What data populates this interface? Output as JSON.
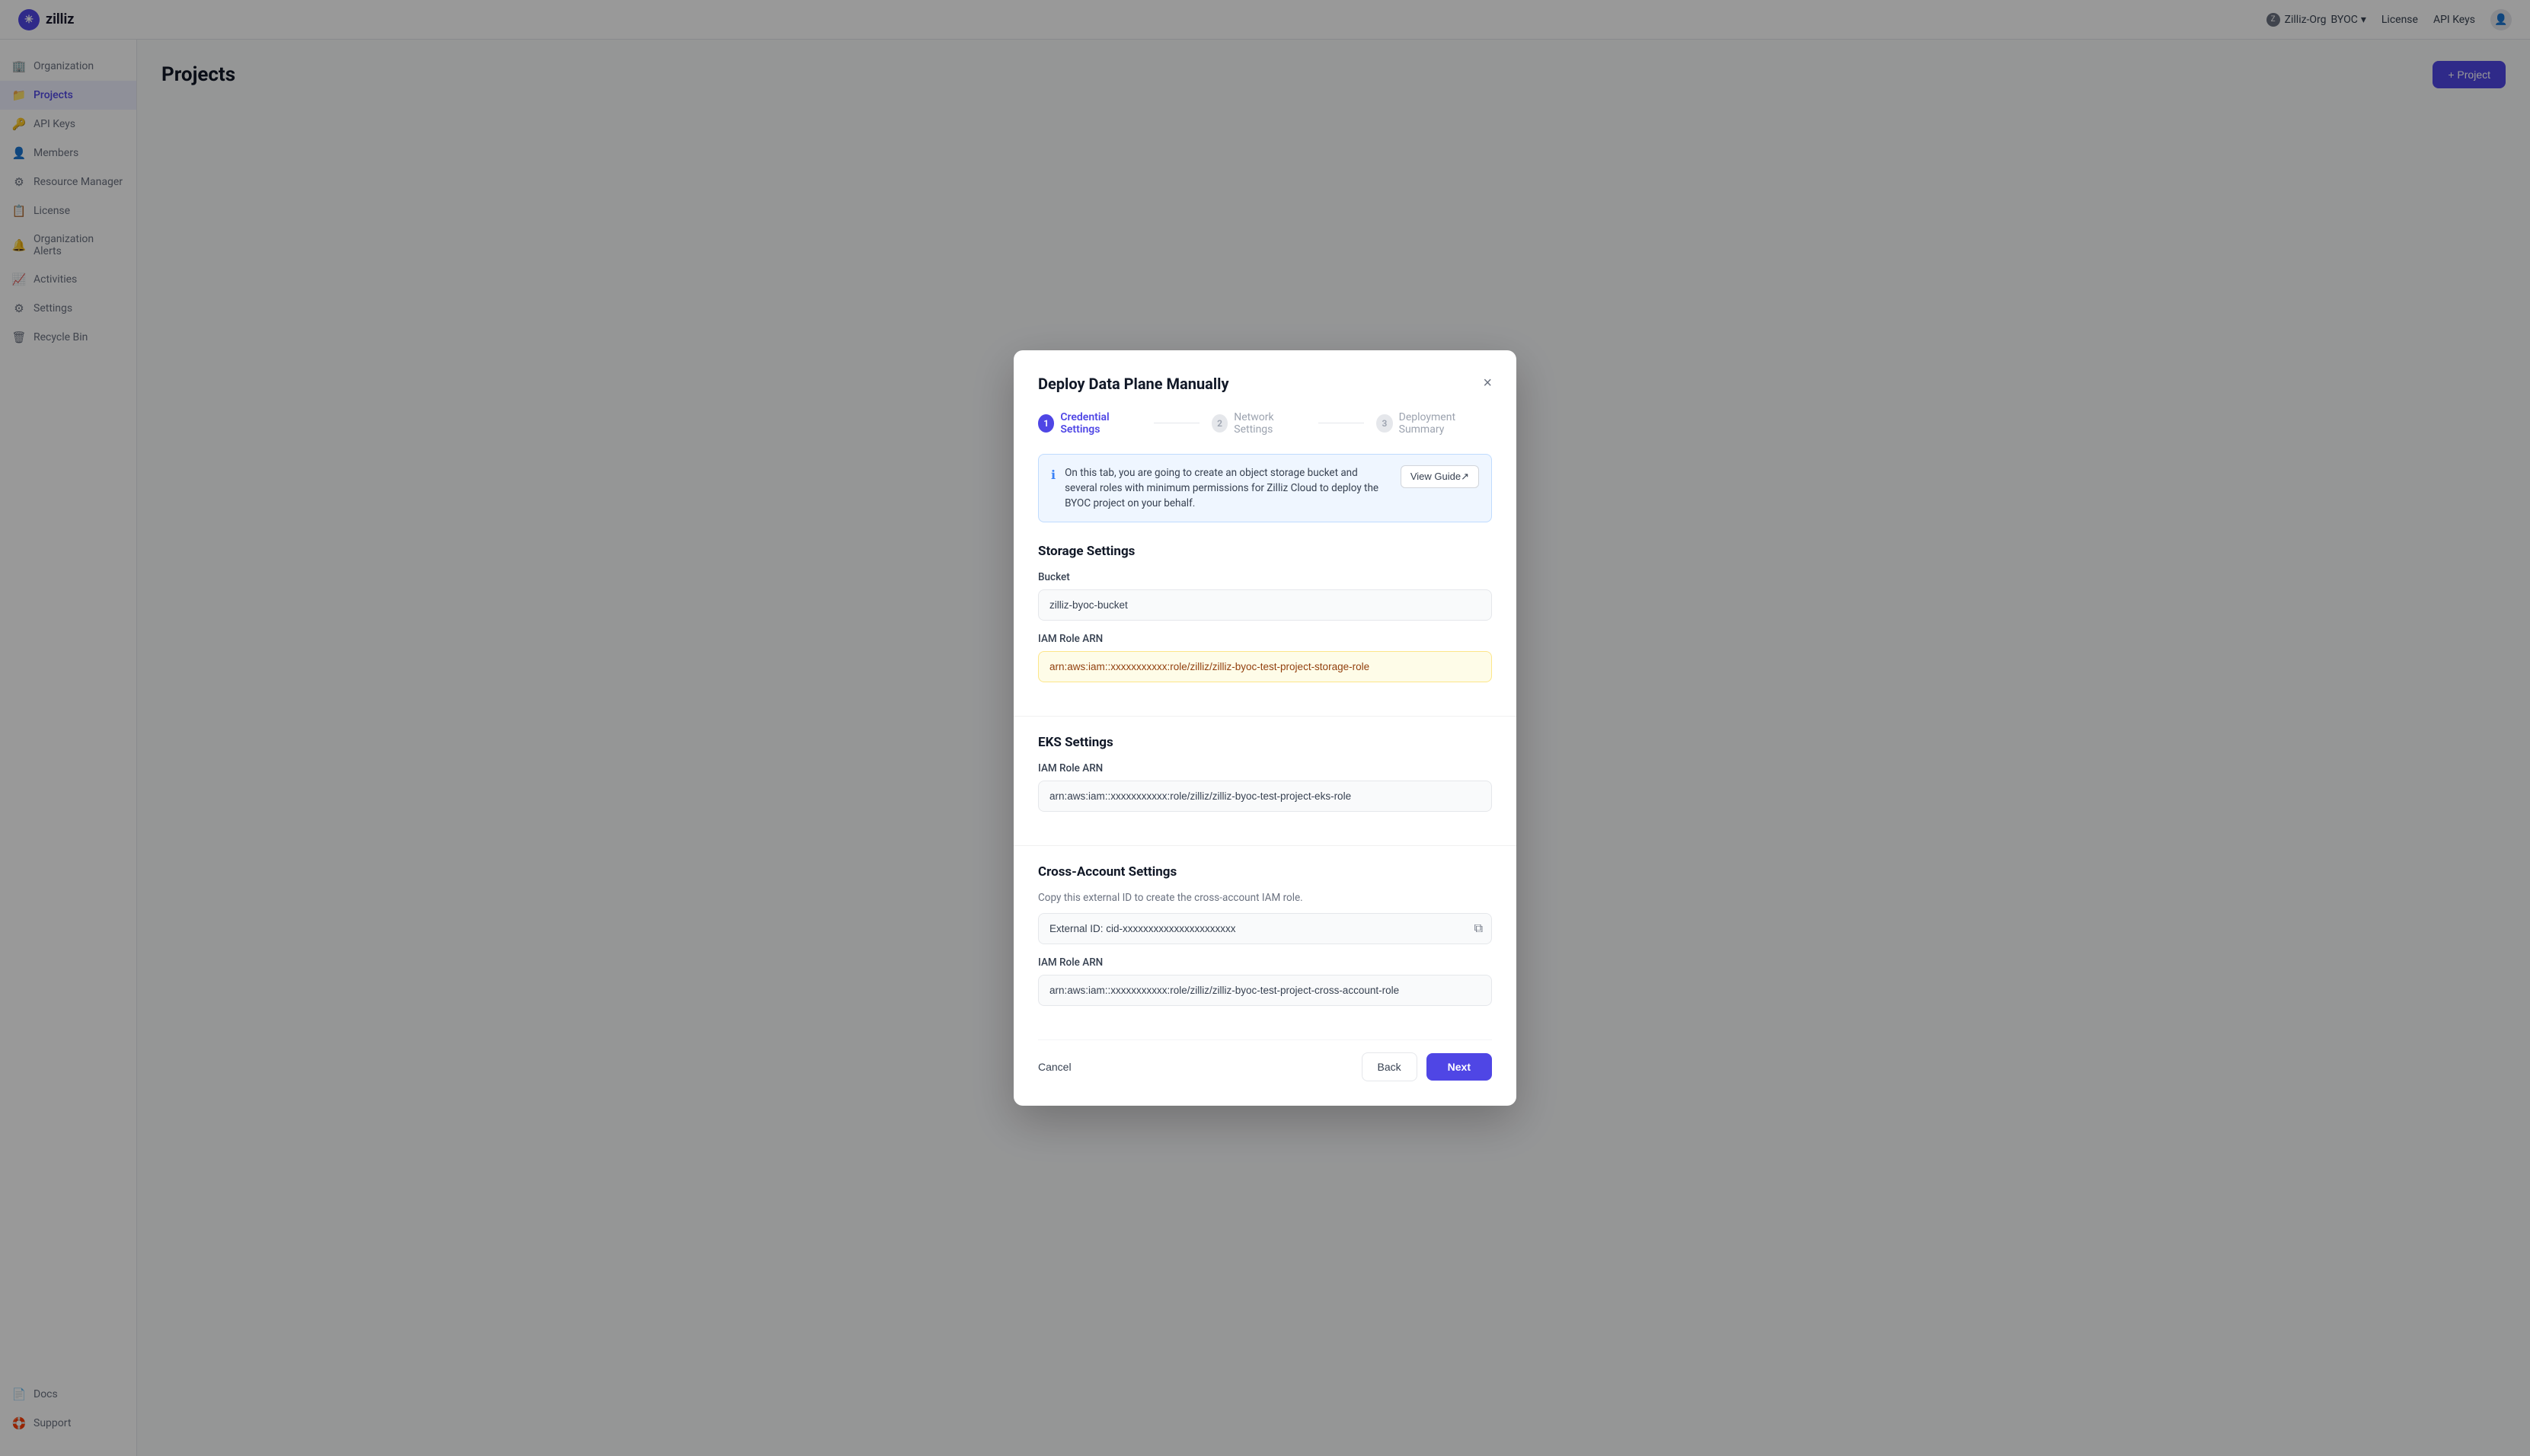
{
  "app": {
    "logo_text": "zilliz",
    "logo_icon": "✳"
  },
  "top_nav": {
    "org_name": "Zilliz-Org",
    "org_type": "BYOC",
    "license_label": "License",
    "api_keys_label": "API Keys"
  },
  "sidebar": {
    "items": [
      {
        "id": "organization",
        "label": "Organization",
        "icon": "🏢"
      },
      {
        "id": "projects",
        "label": "Projects",
        "icon": "📁",
        "active": true
      },
      {
        "id": "api-keys",
        "label": "API Keys",
        "icon": "🔑"
      },
      {
        "id": "members",
        "label": "Members",
        "icon": "👤"
      },
      {
        "id": "resource-manager",
        "label": "Resource Manager",
        "icon": "⚙"
      },
      {
        "id": "license",
        "label": "License",
        "icon": "📋"
      },
      {
        "id": "organization-alerts",
        "label": "Organization Alerts",
        "icon": "🔔"
      },
      {
        "id": "activities",
        "label": "Activities",
        "icon": "📈"
      },
      {
        "id": "settings",
        "label": "Settings",
        "icon": "⚙"
      },
      {
        "id": "recycle-bin",
        "label": "Recycle Bin",
        "icon": "🗑"
      }
    ],
    "bottom_items": [
      {
        "id": "docs",
        "label": "Docs",
        "icon": "📄"
      },
      {
        "id": "support",
        "label": "Support",
        "icon": "🛟"
      }
    ]
  },
  "page": {
    "title": "Projects",
    "add_button": "+ Project"
  },
  "modal": {
    "title": "Deploy Data Plane Manually",
    "close_label": "×",
    "steps": [
      {
        "number": "1",
        "label": "Credential Settings",
        "active": true
      },
      {
        "number": "2",
        "label": "Network Settings",
        "active": false
      },
      {
        "number": "3",
        "label": "Deployment Summary",
        "active": false
      }
    ],
    "info_banner": {
      "text": "On this tab, you are going to create an object storage bucket and several roles with minimum permissions for Zilliz Cloud to deploy the BYOC project on your behalf.",
      "button_label": "View Guide↗"
    },
    "storage_settings": {
      "title": "Storage Settings",
      "bucket_label": "Bucket",
      "bucket_value": "zilliz-byoc-bucket",
      "iam_role_label": "IAM Role ARN",
      "iam_role_value": "arn:aws:iam::xxxxxxxxxxx:role/zilliz/zilliz-byoc-test-project-storage-role"
    },
    "eks_settings": {
      "title": "EKS Settings",
      "iam_role_label": "IAM Role ARN",
      "iam_role_value": "arn:aws:iam::xxxxxxxxxxx:role/zilliz/zilliz-byoc-test-project-eks-role"
    },
    "cross_account": {
      "title": "Cross-Account Settings",
      "description": "Copy this external ID to create the cross-account IAM role.",
      "external_id_label": "External ID",
      "external_id_value": "External ID: cid-xxxxxxxxxxxxxxxxxxxxxx",
      "iam_role_label": "IAM Role ARN",
      "iam_role_value": "arn:aws:iam::xxxxxxxxxxx:role/zilliz/zilliz-byoc-test-project-cross-account-role"
    },
    "footer": {
      "cancel_label": "Cancel",
      "back_label": "Back",
      "next_label": "Next"
    }
  }
}
